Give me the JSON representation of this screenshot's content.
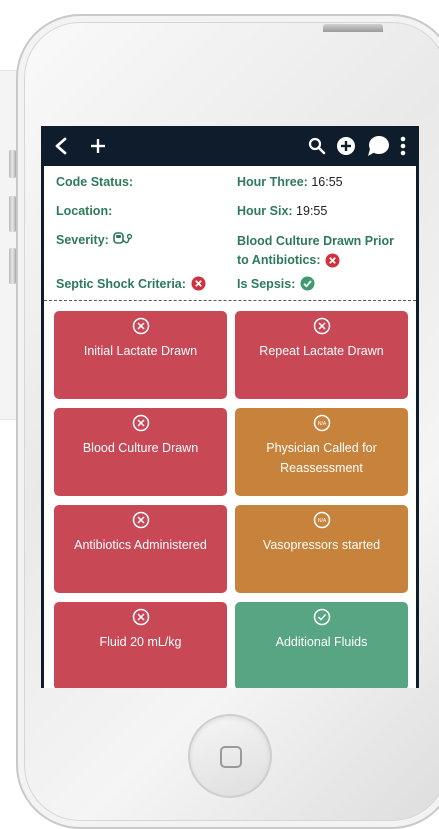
{
  "info": {
    "code_status_label": "Code Status:",
    "code_status_value": "",
    "hour_three_label": "Hour Three:",
    "hour_three_value": "16:55",
    "location_label": "Location:",
    "location_value": "",
    "hour_six_label": "Hour Six:",
    "hour_six_value": "19:55",
    "severity_label": "Severity:",
    "severity_icon": "stethoscope-icon",
    "blood_culture_prior_label_line1": "Blood Culture Drawn Prior",
    "blood_culture_prior_label_line2": "to Antibiotics:",
    "blood_culture_prior_status": "no",
    "septic_shock_label": "Septic Shock Criteria:",
    "septic_shock_status": "no",
    "is_sepsis_label": "Is Sepsis:",
    "is_sepsis_status": "yes"
  },
  "tiles": [
    {
      "label": "Initial Lactate Drawn",
      "status": "not-done"
    },
    {
      "label": "Repeat Lactate Drawn",
      "status": "not-done"
    },
    {
      "label": "Blood Culture Drawn",
      "status": "not-done"
    },
    {
      "label": "Physician Called for Reassessment",
      "status": "n/a"
    },
    {
      "label": "Antibiotics Administered",
      "status": "not-done"
    },
    {
      "label": "Vasopressors started",
      "status": "n/a"
    },
    {
      "label": "Fluid 20 mL/kg",
      "status": "not-done"
    },
    {
      "label": "Additional Fluids",
      "status": "done"
    }
  ],
  "na_text": "N/A",
  "colors": {
    "navbar": "#0f1c2b",
    "label_green": "#2f7a5a",
    "tile_red": "#c84856",
    "tile_orange": "#c7823b",
    "tile_green": "#58a583",
    "status_red": "#d0323d",
    "status_green": "#3f9a6f"
  }
}
